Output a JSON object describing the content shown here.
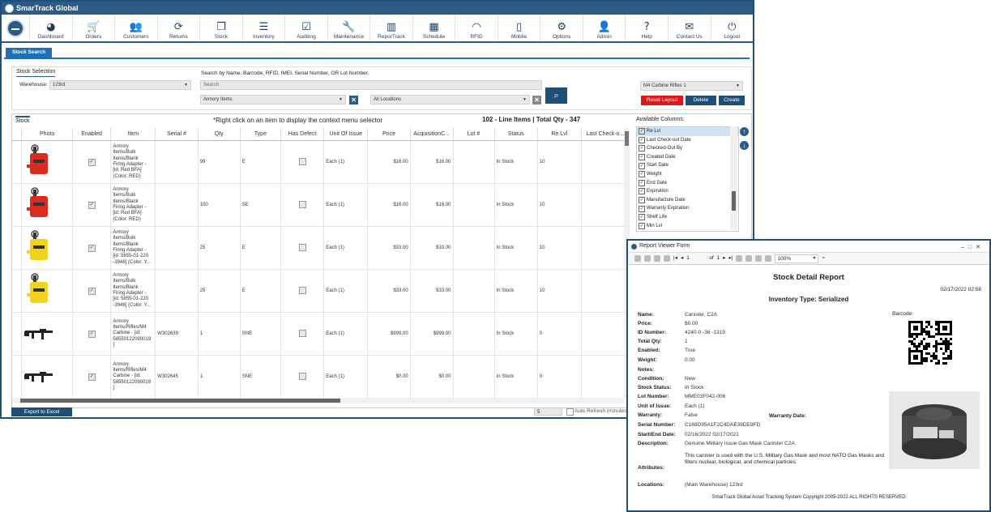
{
  "app": {
    "title": "SmarTrack Global"
  },
  "nav": [
    {
      "label": "Dashboard",
      "icon": "dashboard-icon",
      "glyph": "◕"
    },
    {
      "label": "Orders",
      "icon": "cart-icon",
      "glyph": "🛒"
    },
    {
      "label": "Customers",
      "icon": "users-icon",
      "glyph": "👥"
    },
    {
      "label": "Returns",
      "icon": "refresh-icon",
      "glyph": "⟳"
    },
    {
      "label": "Stock",
      "icon": "copy-icon",
      "glyph": "❐"
    },
    {
      "label": "Inventory",
      "icon": "list-icon",
      "glyph": "☰"
    },
    {
      "label": "Auditing",
      "icon": "calendar-check-icon",
      "glyph": "☑"
    },
    {
      "label": "Maintenance",
      "icon": "wrench-icon",
      "glyph": "🔧"
    },
    {
      "label": "ReporTrack",
      "icon": "bar-chart-icon",
      "glyph": "▥"
    },
    {
      "label": "Schedule",
      "icon": "calendar-icon",
      "glyph": "▦"
    },
    {
      "label": "RFID",
      "icon": "rss-icon",
      "glyph": "◠"
    },
    {
      "label": "Mobile",
      "icon": "mobile-icon",
      "glyph": "▯"
    },
    {
      "label": "Options",
      "icon": "gears-icon",
      "glyph": "⚙"
    },
    {
      "label": "Admin",
      "icon": "user-icon",
      "glyph": "👤"
    },
    {
      "label": "Help",
      "icon": "question-icon",
      "glyph": "?"
    },
    {
      "label": "Contact Us",
      "icon": "envelope-icon",
      "glyph": "✉"
    },
    {
      "label": "Logout",
      "icon": "power-icon",
      "glyph": "⏻"
    }
  ],
  "tab": {
    "label": "Stock Search"
  },
  "selection": {
    "title": "Stock Selection",
    "warehouse_label": "Warehouse:",
    "warehouse_value": "123rd",
    "search_hint": "Search by Name, Barcode, RFID, IMEI, Serial Number, OR Lot Number.",
    "search_placeholder": "Search",
    "category_value": "Armory Items",
    "location_value": "All Locations",
    "layout_value": "M4 Carbine Rifles 1",
    "reset_label": "Reset Layout",
    "delete_label": "Delete",
    "create_label": "Create"
  },
  "stock": {
    "title": "Stock",
    "hint": "*Right click on an item to display the context menu selector",
    "counts": "102  - Line Items   |  Total Qty -  347",
    "columns": [
      "Photo",
      "Enabled",
      "Item",
      "Serial #",
      "Qty",
      "Type",
      "Has Defect",
      "Unit Of Issue",
      "Price",
      "AcquisitionC...",
      "Lot #",
      "Status",
      "Re Lvl",
      "Last Check-o..."
    ],
    "rows": [
      {
        "photo": "red",
        "enabled": "✓",
        "item": "Armory\nItems/Bulk\nItems/Blank\nFiring Adapter -\n[id: Red BFA]\n(Color: RED)",
        "serial": "",
        "qty": "99",
        "type": "E",
        "unit": "Each (1)",
        "price": "$16.00",
        "acq": "$16.00",
        "lot": "",
        "status": "In Stock",
        "relvl": "10"
      },
      {
        "photo": "red",
        "enabled": "✓",
        "item": "Armory\nItems/Bulk\nItems/Blank\nFiring Adapter -\n[id: Red BFA]\n(Color: RED)",
        "serial": "",
        "qty": "100",
        "type": "SE",
        "unit": "Each (1)",
        "price": "$16.00",
        "acq": "$16.00",
        "lot": "",
        "status": "In Stock",
        "relvl": "10"
      },
      {
        "photo": "yellow",
        "enabled": "✓",
        "item": "Armory\nItems/Bulk\nItems/Blank\nFiring Adapter -\n[id: 5855-01-220\n-3948] (Color: Y...",
        "serial": "",
        "qty": "25",
        "type": "E",
        "unit": "Each (1)",
        "price": "$33.00",
        "acq": "$33.00",
        "lot": "",
        "status": "In Stock",
        "relvl": "10"
      },
      {
        "photo": "yellow",
        "enabled": "✓",
        "item": "Armory\nItems/Bulk\nItems/Blank\nFiring Adapter -\n[id: 5855-01-220\n-3948] (Color: Y...",
        "serial": "",
        "qty": "25",
        "type": "E",
        "unit": "Each (1)",
        "price": "$33.00",
        "acq": "$33.00",
        "lot": "",
        "status": "In Stock",
        "relvl": "10"
      },
      {
        "photo": "rifle",
        "enabled": "✓",
        "item": "Armory\nItems/Rifles/M4\nCarbine - [id:\n58550122090019\n]",
        "serial": "W302639",
        "qty": "1",
        "type": "SNE",
        "unit": "Each (1)",
        "price": "$999.00",
        "acq": "$999.00",
        "lot": "",
        "status": "In Stock",
        "relvl": "0"
      },
      {
        "photo": "rifle",
        "enabled": "✓",
        "item": "Armory\nItems/Rifles/M4\nCarbine - [id:\n58550122090019\n]",
        "serial": "W302645",
        "qty": "1",
        "type": "SNE",
        "unit": "Each (1)",
        "price": "$0.00",
        "acq": "$0.00",
        "lot": "",
        "status": "In Stock",
        "relvl": "0"
      }
    ],
    "export_label": "Export to Excel",
    "page_value": "5",
    "auto_refresh": "Auto Refresh (minutes)"
  },
  "available": {
    "title": "Available Columns:",
    "items": [
      "Re Lvl",
      "Last Check-out Date",
      "Checked-Out By",
      "Created Date",
      "Start Date",
      "Weight",
      "End Date",
      "Expiration",
      "Manufacture Date",
      "Warranty Expiration",
      "Shelf Life",
      "Min Lvl"
    ]
  },
  "report": {
    "window_title": "Report Viewer Form",
    "page_current": "1",
    "page_of": "of",
    "page_total": "1",
    "zoom": "100%",
    "title": "Stock Detail Report",
    "date": "02/17/2022 02:58",
    "subtitle": "Inventory Type: Serialized",
    "barcode_label": "Barcode:",
    "fields": [
      {
        "label": "Name:",
        "value": "Canister, C2A"
      },
      {
        "label": "Price:",
        "value": "$0.00"
      },
      {
        "label": "ID Number:",
        "value": "4240-0 -36 -1319"
      },
      {
        "label": "Total Qty:",
        "value": "1"
      },
      {
        "label": "Enabled:",
        "value": "True"
      },
      {
        "label": "Weight:",
        "value": "0.00"
      },
      {
        "label": "Notes:",
        "value": ""
      },
      {
        "label": "Condition:",
        "value": "New"
      },
      {
        "label": "Stock Status:",
        "value": "In Stock"
      },
      {
        "label": "Lot Number:",
        "value": "MME03F042-006"
      },
      {
        "label": "Unit of Issue:",
        "value": "Each (1)"
      },
      {
        "label": "Warranty:",
        "value": "False"
      },
      {
        "label": "Serial Number:",
        "value": "C168D95A1F2C4DAE39DE9FD"
      },
      {
        "label": "Start/End Date:",
        "value": "02/16/2022          02/17/2021"
      },
      {
        "label": "Description:",
        "value": "Genuine Military Issue Gas Mask Canister C2A"
      }
    ],
    "warranty_date_label": "Warranty Date:",
    "description_extra": "This canister is used with the U.S. Military Gas Mask and most NATO Gas Masks and filters nuclear, biological, and chemical particles.",
    "attributes_label": "Attributes:",
    "locations_label": "Locations:",
    "locations_value": "(Main Warehouse) 123rd",
    "footer": "SmarTrack Global Asset Tracking System  Copyright 2005-2022  ALL RIGHTS RESERVED"
  },
  "colors": {
    "brand": "#2b5b86",
    "accent": "#1e6fb5",
    "reset": "#e0161b",
    "dark_button": "#1f4e79"
  }
}
